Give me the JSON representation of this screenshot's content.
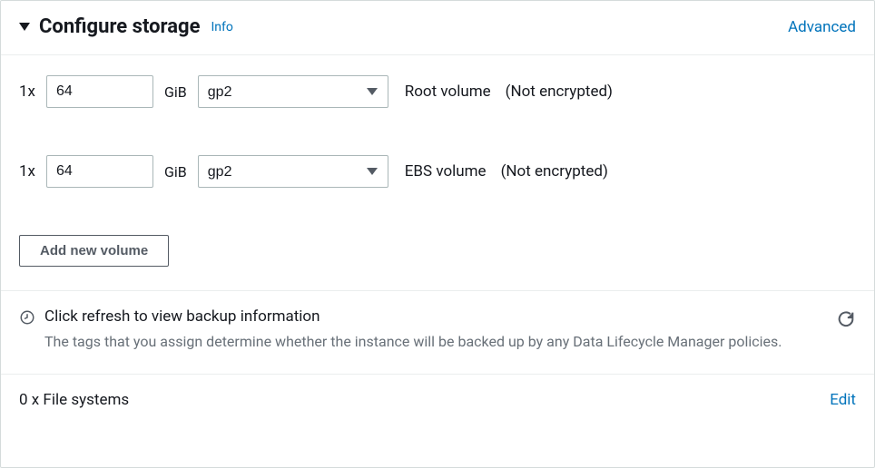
{
  "header": {
    "title": "Configure storage",
    "info_link": "Info",
    "advanced_link": "Advanced"
  },
  "volumes": [
    {
      "qty": "1x",
      "size": "64",
      "unit": "GiB",
      "type": "gp2",
      "label": "Root volume",
      "encryption": "(Not encrypted)"
    },
    {
      "qty": "1x",
      "size": "64",
      "unit": "GiB",
      "type": "gp2",
      "label": "EBS volume",
      "encryption": "(Not encrypted)"
    }
  ],
  "add_volume_button": "Add new volume",
  "backup": {
    "title": "Click refresh to view backup information",
    "description": "The tags that you assign determine whether the instance will be backed up by any Data Lifecycle Manager policies."
  },
  "filesystems": {
    "label": "0 x File systems",
    "edit_link": "Edit"
  }
}
